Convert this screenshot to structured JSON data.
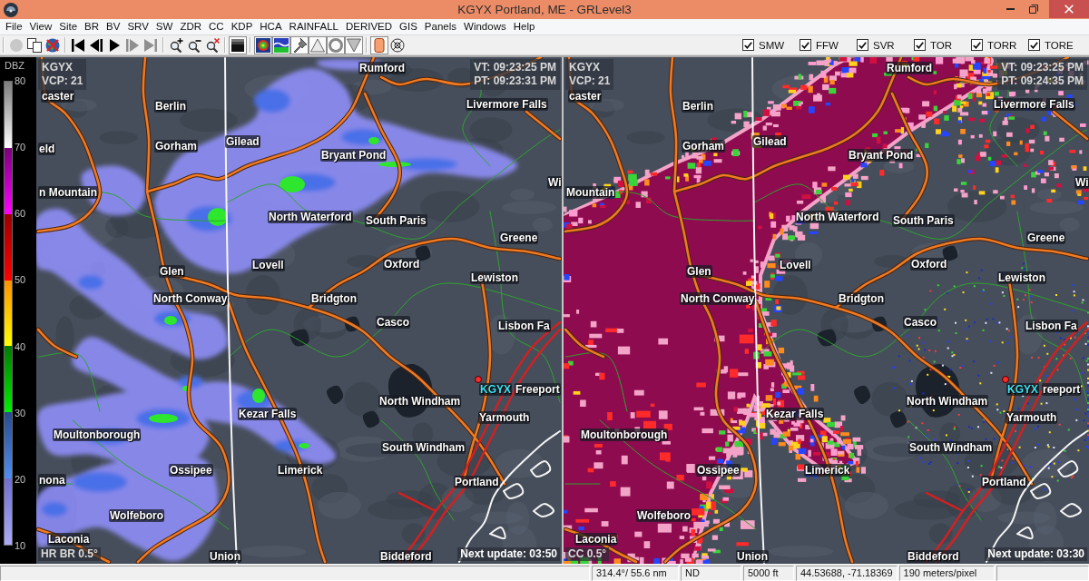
{
  "window": {
    "title": "KGYX Portland, ME - GRLevel3"
  },
  "menu": [
    "File",
    "View",
    "Site",
    "BR",
    "BV",
    "SRV",
    "SW",
    "ZDR",
    "CC",
    "KDP",
    "HCA",
    "RAINFALL",
    "DERIVED",
    "GIS",
    "Panels",
    "Windows",
    "Help"
  ],
  "toolbar": {
    "buttons": [
      {
        "pressed": false,
        "disabled": true
      },
      {
        "pressed": false,
        "disabled": false
      },
      {
        "pressed": false,
        "disabled": false
      },
      {
        "pressed": false,
        "disabled": false
      },
      {
        "pressed": false,
        "disabled": false
      },
      {
        "pressed": false,
        "disabled": false
      },
      {
        "pressed": false,
        "disabled": true
      },
      {
        "pressed": false,
        "disabled": true
      },
      {
        "pressed": false,
        "disabled": false
      },
      {
        "pressed": false,
        "disabled": false
      },
      {
        "pressed": false,
        "disabled": false
      },
      {
        "pressed": true,
        "disabled": false
      },
      {
        "pressed": true,
        "disabled": false
      },
      {
        "pressed": true,
        "disabled": false
      },
      {
        "pressed": true,
        "disabled": false
      },
      {
        "pressed": true,
        "disabled": false
      },
      {
        "pressed": true,
        "disabled": false
      },
      {
        "pressed": true,
        "disabled": false
      },
      {
        "pressed": true,
        "disabled": false
      },
      {
        "pressed": false,
        "disabled": false
      }
    ],
    "warnings": [
      {
        "label": "SMW",
        "checked": true
      },
      {
        "label": "FFW",
        "checked": true
      },
      {
        "label": "SVR",
        "checked": true
      },
      {
        "label": "TOR",
        "checked": true
      },
      {
        "label": "TORR",
        "checked": true
      },
      {
        "label": "TORE",
        "checked": true
      }
    ]
  },
  "legend": {
    "title": "DBZ",
    "ticks": [
      "80",
      "70",
      "60",
      "50",
      "40",
      "30",
      "20",
      "10"
    ]
  },
  "panels": [
    {
      "kind": "reflectivity",
      "site": "KGYX",
      "vcp": "VCP: 21",
      "valid_time": "VT: 09:23:25 PM",
      "product_time": "PT: 09:23:31 PM",
      "product": "HR BR 0.5°",
      "next_update": "Next update: 03:50",
      "site_marker_label": "KGYX",
      "places": [
        "caster",
        "Rumford",
        "Berlin",
        "Livermore Falls",
        "eld",
        "Gorham",
        "Gilead",
        "Bryant Pond",
        "n Mountain",
        "Wi",
        "North Waterford",
        "South Paris",
        "Greene",
        "Lovell",
        "Oxford",
        "Glen",
        "Lewiston",
        "North Conway",
        "Bridgton",
        "Casco",
        "Lisbon Fa",
        "Freeport",
        "North Windham",
        "Yarmouth",
        "Kezar Falls",
        "Moultonborough",
        "South Windham",
        "Ossipee",
        "Limerick",
        "Portland",
        "nona",
        "Wolfeboro",
        "Laconia",
        "Union",
        "Biddeford"
      ]
    },
    {
      "kind": "correlation",
      "site": "KGYX",
      "vcp": "VCP: 21",
      "valid_time": "VT: 09:23:25 PM",
      "product_time": "PT: 09:24:35 PM",
      "product": "CC 0.5°",
      "next_update": "Next update: 03:30",
      "site_marker_label": "KGYX",
      "places": [
        "caster",
        "Rumford",
        "Berlin",
        "Livermore Falls",
        "Gorham",
        "Gilead",
        "Bryant Pond",
        "Mountain",
        "Wi",
        "North Waterford",
        "South Paris",
        "Greene",
        "Lovell",
        "Oxford",
        "Glen",
        "Lewiston",
        "North Conway",
        "Bridgton",
        "Casco",
        "Lisbon Fa",
        "reeport",
        "North Windham",
        "Yarmouth",
        "Kezar Falls",
        "Moultonborough",
        "South Windham",
        "Ossipee",
        "Limerick",
        "Portland",
        "Wolfeboro",
        "Laconia",
        "Union",
        "Biddeford"
      ]
    }
  ],
  "status_bar": {
    "cells": [
      "314.4°/ 55.6 nm",
      "ND",
      "5000 ft",
      "44.53688, -71.18369",
      "190 meters/pixel"
    ]
  }
}
